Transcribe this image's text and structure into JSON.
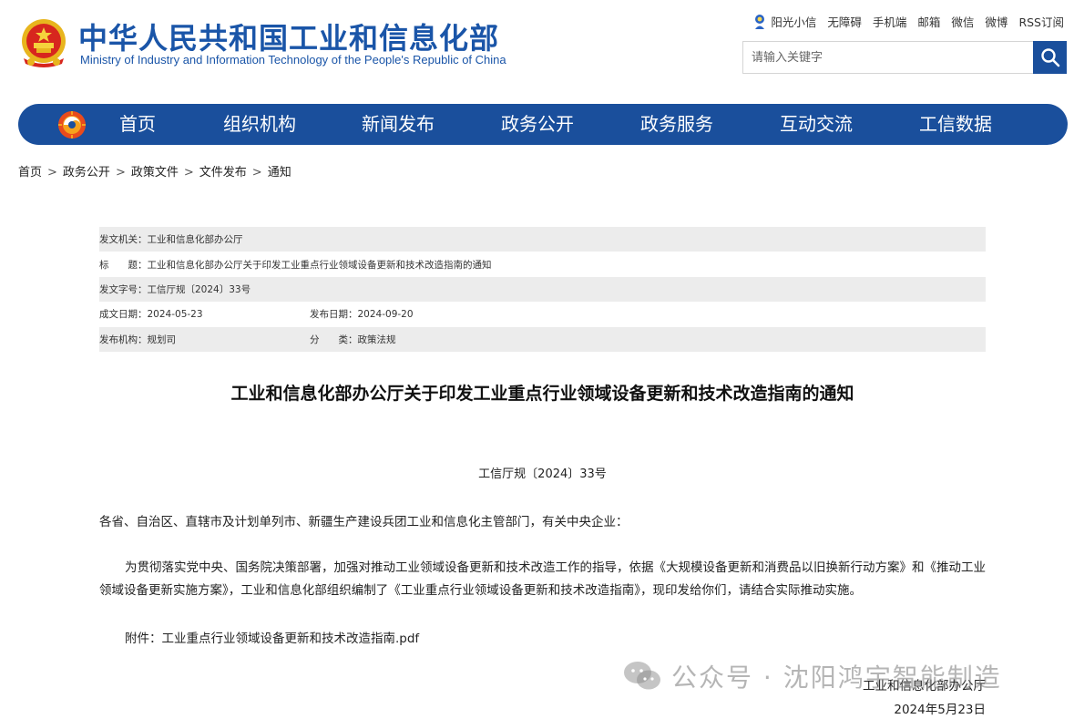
{
  "header": {
    "title_cn": "中华人民共和国工业和信息化部",
    "title_en": "Ministry of Industry and Information Technology of the People's Republic of China",
    "links": [
      "阳光小信",
      "无障碍",
      "手机端",
      "邮箱",
      "微信",
      "微博",
      "RSS订阅"
    ],
    "search_placeholder": "请输入关键字"
  },
  "nav": {
    "items": [
      "首页",
      "组织机构",
      "新闻发布",
      "政务公开",
      "政务服务",
      "互动交流",
      "工信数据"
    ]
  },
  "breadcrumb": [
    "首页",
    "政务公开",
    "政策文件",
    "文件发布",
    "通知"
  ],
  "meta": {
    "issuer_label": "发文机关：",
    "issuer_value": "工业和信息化部办公厅",
    "title_label": "标　　题：",
    "title_value": "工业和信息化部办公厅关于印发工业重点行业领域设备更新和技术改造指南的通知",
    "doc_no_label": "发文字号：",
    "doc_no_value": "工信厅规〔2024〕33号",
    "created_label": "成文日期：",
    "created_value": "2024-05-23",
    "published_label": "发布日期：",
    "published_value": "2024-09-20",
    "org_label": "发布机构：",
    "org_value": "规划司",
    "category_label": "分　　类：",
    "category_value": "政策法规"
  },
  "document": {
    "title": "工业和信息化部办公厅关于印发工业重点行业领域设备更新和技术改造指南的通知",
    "number": "工信厅规〔2024〕33号",
    "addressee": "各省、自治区、直辖市及计划单列市、新疆生产建设兵团工业和信息化主管部门，有关中央企业：",
    "body": "为贯彻落实党中央、国务院决策部署，加强对推动工业领域设备更新和技术改造工作的指导，依据《大规模设备更新和消费品以旧换新行动方案》和《推动工业领域设备更新实施方案》，工业和信息化部组织编制了《工业重点行业领域设备更新和技术改造指南》，现印发给你们，请结合实际推动实施。",
    "attachment_label": "附件：",
    "attachment_link": "工业重点行业领域设备更新和技术改造指南.pdf",
    "signer": "工业和信息化部办公厅",
    "date": "2024年5月23日"
  },
  "watermark": {
    "text": "公众号 · 沈阳鸿宇智能制造",
    "icon": "wechat-icon"
  },
  "colors": {
    "brand_blue": "#1a4f9c",
    "title_blue": "#1a55a8",
    "meta_shade": "#ececec"
  }
}
